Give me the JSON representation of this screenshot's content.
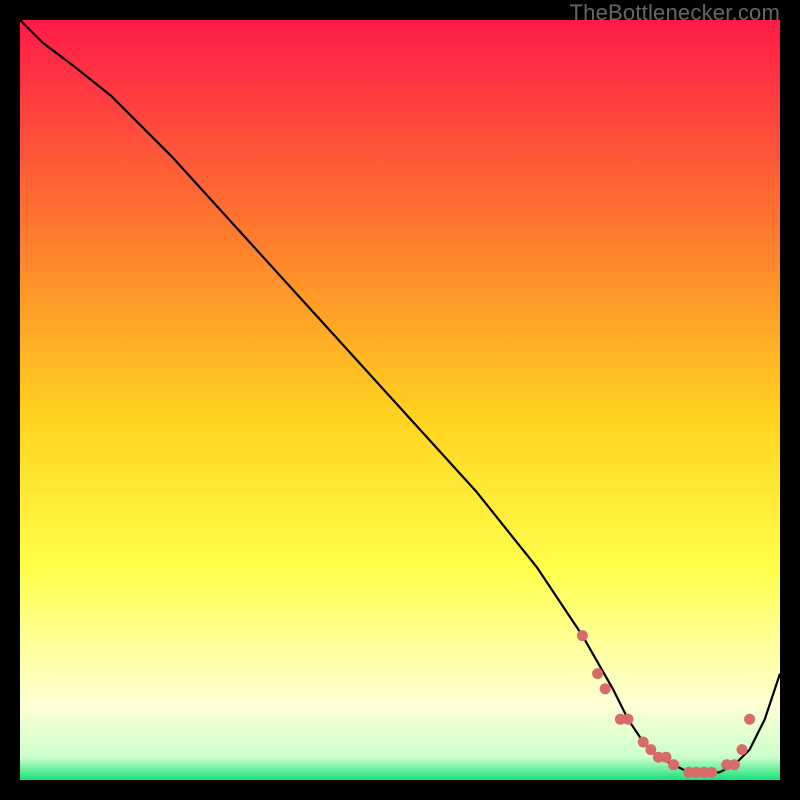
{
  "attribution": "TheBottlenecker.com",
  "colors": {
    "gradient_top": "#ff1a4a",
    "gradient_mid1": "#ff7a2e",
    "gradient_mid2": "#ffd21f",
    "gradient_mid3": "#ffff4a",
    "gradient_low": "#ffffd6",
    "gradient_green": "#18e07a",
    "curve": "#000000",
    "dots": "#d86a6a"
  },
  "chart_data": {
    "type": "line",
    "title": "",
    "xlabel": "",
    "ylabel": "",
    "xlim": [
      0,
      100
    ],
    "ylim": [
      0,
      100
    ],
    "series": [
      {
        "name": "bottleneck-curve",
        "x": [
          0,
          3,
          7,
          12,
          20,
          30,
          40,
          50,
          60,
          68,
          74,
          78,
          80,
          82,
          84,
          86,
          88,
          90,
          92,
          94,
          96,
          98,
          100
        ],
        "y": [
          100,
          97,
          94,
          90,
          82,
          71,
          60,
          49,
          38,
          28,
          19,
          12,
          8,
          5,
          3,
          2,
          1,
          1,
          1,
          2,
          4,
          8,
          14
        ]
      }
    ],
    "scatter": {
      "name": "sample-points",
      "x": [
        74,
        76,
        77,
        79,
        80,
        82,
        83,
        84,
        85,
        86,
        88,
        89,
        90,
        91,
        93,
        94,
        95,
        96
      ],
      "y": [
        19,
        14,
        12,
        8,
        8,
        5,
        4,
        3,
        3,
        2,
        1,
        1,
        1,
        1,
        2,
        2,
        4,
        8
      ]
    }
  }
}
